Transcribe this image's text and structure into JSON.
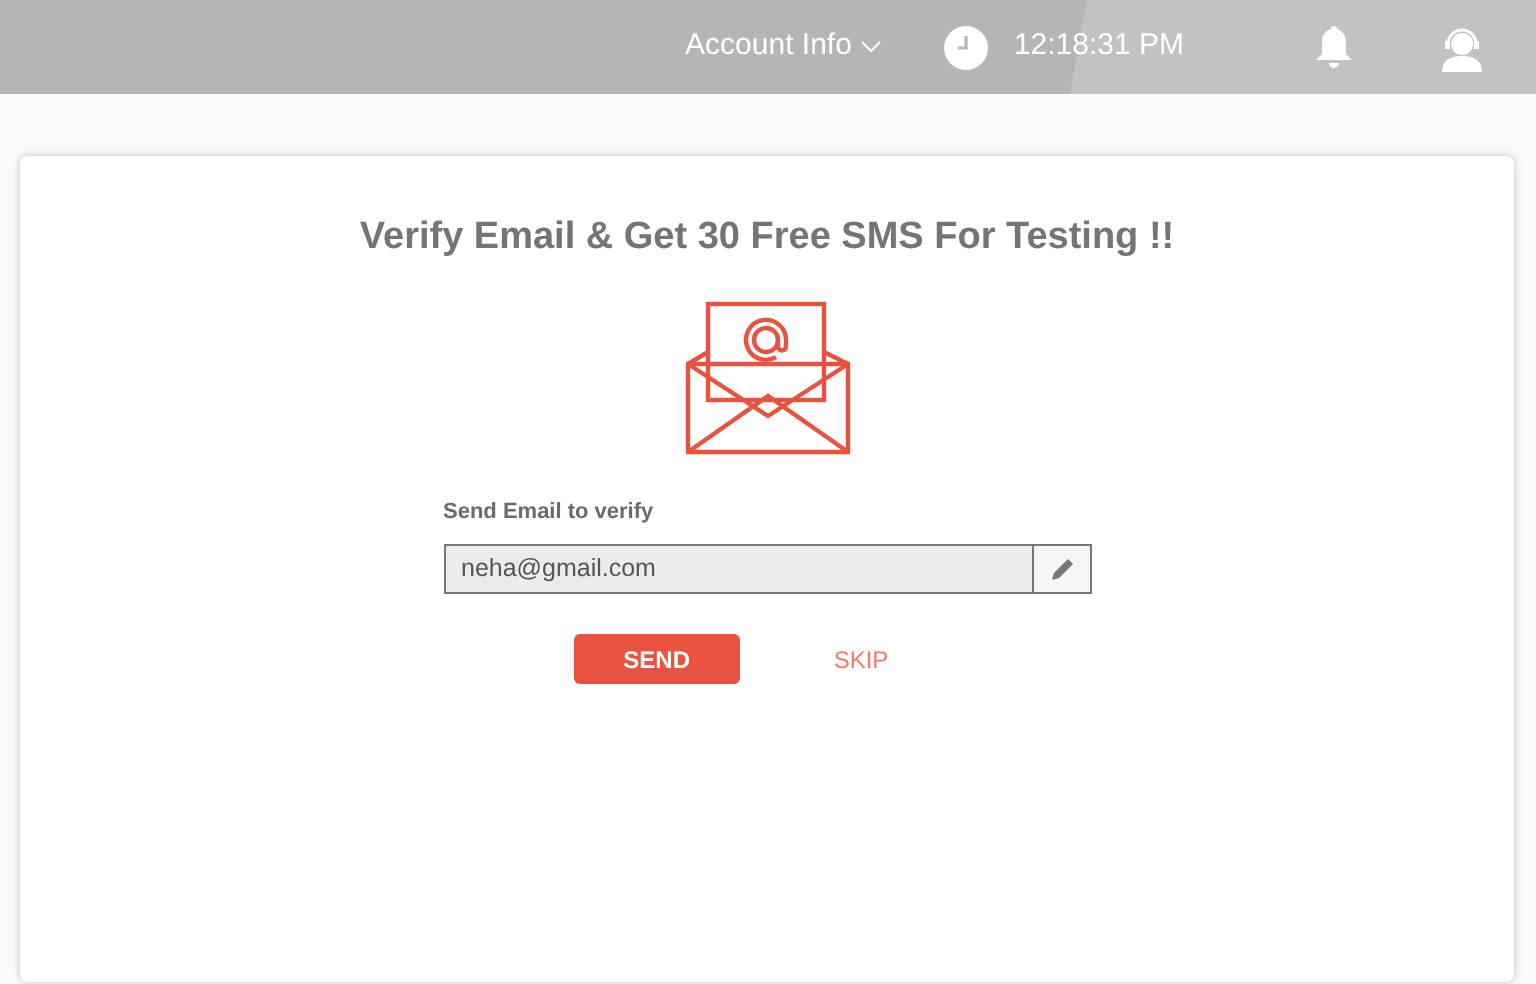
{
  "topbar": {
    "account_menu": "Account Info",
    "time": "12:18:31 PM"
  },
  "card": {
    "title": "Verify Email & Get 30 Free SMS For Testing !!",
    "email_label": "Send Email to verify",
    "email_value": "neha@gmail.com",
    "email_readonly": true,
    "buttons": [
      {
        "label": "SEND",
        "kind": "primary"
      },
      {
        "label": "SKIP",
        "kind": "link"
      }
    ]
  }
}
